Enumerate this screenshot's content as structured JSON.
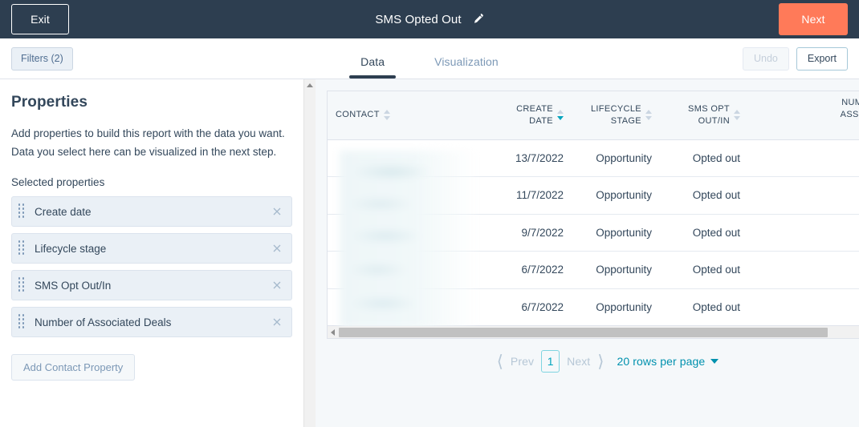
{
  "topbar": {
    "exit_label": "Exit",
    "report_title": "SMS Opted Out",
    "edit_icon": "pencil-icon",
    "next_label": "Next",
    "background_color": "#2d3e50",
    "next_color": "#ff7a59"
  },
  "toolbar": {
    "filters_label": "Filters (2)",
    "undo_label": "Undo",
    "export_label": "Export",
    "tabs": [
      {
        "label": "Data",
        "active": true
      },
      {
        "label": "Visualization",
        "active": false
      }
    ]
  },
  "left_panel": {
    "heading": "Properties",
    "description": "Add properties to build this report with the data you want. Data you select here can be visualized in the next step.",
    "selected_label": "Selected properties",
    "properties": [
      {
        "name": "Create date"
      },
      {
        "name": "Lifecycle stage"
      },
      {
        "name": "SMS Opt Out/In"
      },
      {
        "name": "Number of Associated Deals"
      }
    ],
    "add_property_label": "Add Contact Property"
  },
  "table": {
    "columns": [
      {
        "key": "contact",
        "label": "CONTACT",
        "sorted": false,
        "direction": "none"
      },
      {
        "key": "date",
        "label": "CREATE\nDATE",
        "sorted": true,
        "direction": "desc"
      },
      {
        "key": "stage",
        "label": "LIFECYCLE\nSTAGE",
        "sorted": false,
        "direction": "none"
      },
      {
        "key": "sms",
        "label": "SMS OPT\nOUT/IN",
        "sorted": false,
        "direction": "none"
      },
      {
        "key": "deals",
        "label": "NUMBER\nASSOCIA\nDE",
        "sorted": false,
        "direction": "none"
      }
    ],
    "rows": [
      {
        "contact": "",
        "date": "13/7/2022",
        "stage": "Opportunity",
        "sms": "Opted out",
        "deals": ""
      },
      {
        "contact": "",
        "date": "11/7/2022",
        "stage": "Opportunity",
        "sms": "Opted out",
        "deals": ""
      },
      {
        "contact": "",
        "date": "9/7/2022",
        "stage": "Opportunity",
        "sms": "Opted out",
        "deals": ""
      },
      {
        "contact": "",
        "date": "6/7/2022",
        "stage": "Opportunity",
        "sms": "Opted out",
        "deals": ""
      },
      {
        "contact": "",
        "date": "6/7/2022",
        "stage": "Opportunity",
        "sms": "Opted out",
        "deals": ""
      }
    ]
  },
  "pagination": {
    "prev_label": "Prev",
    "current_page": "1",
    "next_label": "Next",
    "rows_per_page_label": "20 rows per page"
  },
  "colors": {
    "accent_teal": "#00a4bd",
    "brand_orange": "#ff7a59",
    "navy": "#2d3e50",
    "panel_bg": "#f5f8fa"
  }
}
